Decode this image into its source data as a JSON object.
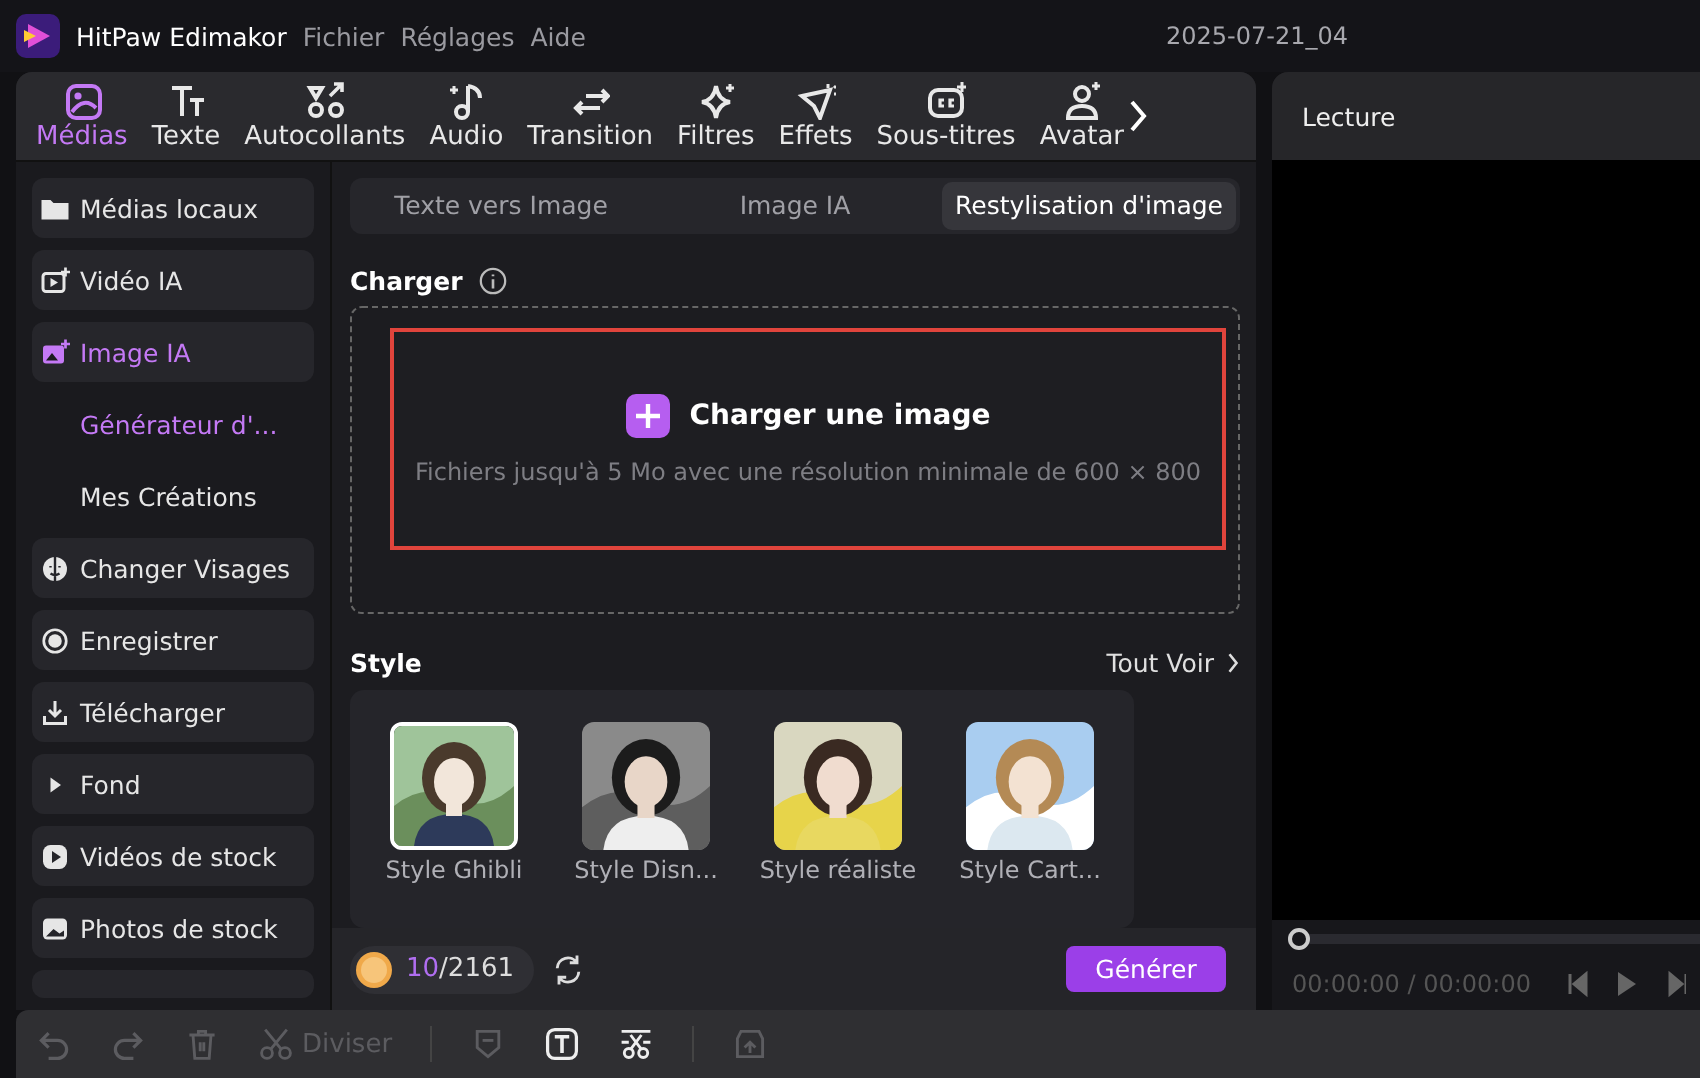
{
  "app": {
    "name": "HitPaw Edimakor",
    "menu": [
      "Fichier",
      "Réglages",
      "Aide"
    ],
    "project": "2025-07-21_04"
  },
  "tabs": [
    {
      "label": "Médias",
      "selected": true
    },
    {
      "label": "Texte",
      "selected": false
    },
    {
      "label": "Autocollants",
      "selected": false
    },
    {
      "label": "Audio",
      "selected": false
    },
    {
      "label": "Transition",
      "selected": false
    },
    {
      "label": "Filtres",
      "selected": false
    },
    {
      "label": "Effets",
      "selected": false
    },
    {
      "label": "Sous-titres",
      "selected": false
    },
    {
      "label": "Avatar",
      "selected": false
    }
  ],
  "sidebar": {
    "items": [
      {
        "kind": "item",
        "label": "Médias locaux",
        "selected": false
      },
      {
        "kind": "item",
        "label": "Vidéo IA",
        "selected": false
      },
      {
        "kind": "item",
        "label": "Image IA",
        "selected": true
      },
      {
        "kind": "sub",
        "label": "Générateur d'...",
        "selected": true
      },
      {
        "kind": "sub",
        "label": "Mes Créations",
        "selected": false
      },
      {
        "kind": "item",
        "label": "Changer Visages",
        "selected": false
      },
      {
        "kind": "item",
        "label": "Enregistrer",
        "selected": false
      },
      {
        "kind": "item",
        "label": "Télécharger",
        "selected": false
      },
      {
        "kind": "item",
        "label": "Fond",
        "selected": false
      },
      {
        "kind": "item",
        "label": "Vidéos de stock",
        "selected": false
      },
      {
        "kind": "item",
        "label": "Photos de stock",
        "selected": false
      }
    ]
  },
  "subtabs": [
    {
      "label": "Texte vers Image",
      "selected": false
    },
    {
      "label": "Image IA",
      "selected": false
    },
    {
      "label": "Restylisation d'image",
      "selected": true
    }
  ],
  "upload": {
    "label": "Charger",
    "button": "Charger une image",
    "hint": "Fichiers jusqu'à 5 Mo avec une résolution minimale de 600 × 800"
  },
  "style": {
    "label": "Style",
    "see_all": "Tout Voir",
    "items": [
      {
        "name": "Style Ghibli",
        "selected": true
      },
      {
        "name": "Style Disn...",
        "selected": false
      },
      {
        "name": "Style réaliste",
        "selected": false
      },
      {
        "name": "Style Cart...",
        "selected": false
      }
    ]
  },
  "credits": {
    "used": "10",
    "total": "/2161"
  },
  "generate": "Générer",
  "player": {
    "title": "Lecture",
    "level": 0,
    "time": "00:00:00 / 00:00:00"
  },
  "toolbar": [
    {
      "kind": "tool",
      "disabled": true
    },
    {
      "kind": "tool",
      "disabled": true
    },
    {
      "kind": "tool",
      "disabled": true
    },
    {
      "kind": "tool",
      "label": "Diviser",
      "disabled": true
    },
    {
      "kind": "sep"
    },
    {
      "kind": "tool",
      "disabled": true
    },
    {
      "kind": "tool",
      "disabled": false
    },
    {
      "kind": "tool",
      "disabled": false
    },
    {
      "kind": "sep"
    },
    {
      "kind": "tool",
      "disabled": true
    }
  ]
}
